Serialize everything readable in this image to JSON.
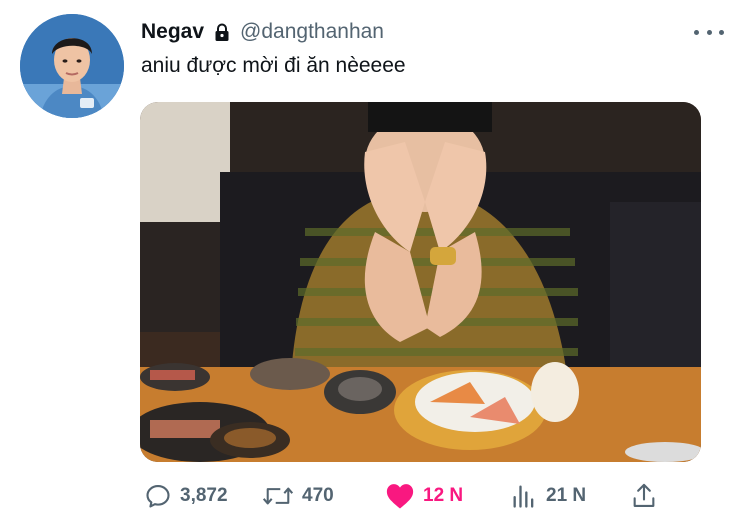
{
  "author": {
    "display_name": "Negav",
    "handle": "@dangthanhan"
  },
  "tweet": {
    "text": "aniu được mời đi ăn nèeeee"
  },
  "actions": {
    "replies": "3,872",
    "retweets": "470",
    "likes": "12 N",
    "views": "21 N"
  },
  "colors": {
    "like_accent": "#f91880",
    "muted": "#536471",
    "text": "#0f1419"
  },
  "icons": [
    "lock-icon",
    "more-icon",
    "reply-icon",
    "retweet-icon",
    "heart-icon",
    "views-icon",
    "share-icon"
  ]
}
